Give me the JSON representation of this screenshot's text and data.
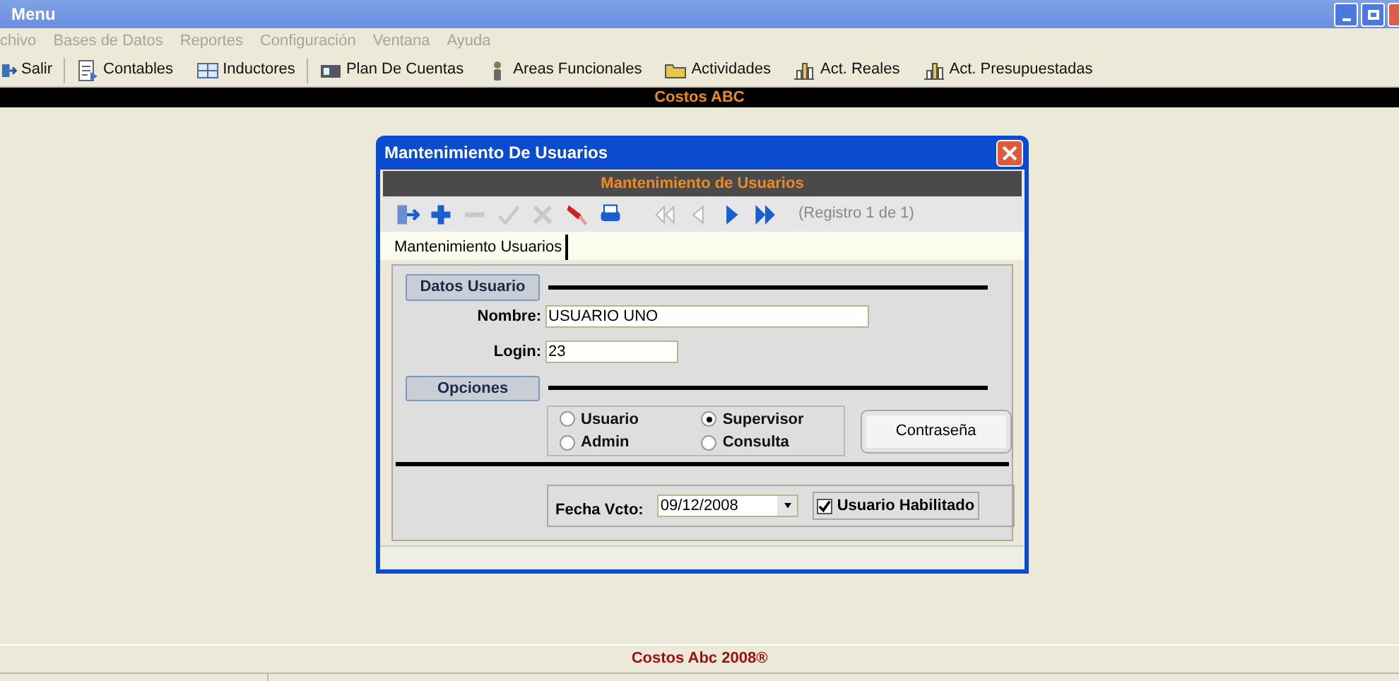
{
  "window": {
    "title": "Menu"
  },
  "menu": [
    {
      "label": "chivo",
      "disabled": true
    },
    {
      "label": "Bases de Datos",
      "disabled": true
    },
    {
      "label": "Reportes",
      "disabled": true
    },
    {
      "label": "Configuración",
      "disabled": true
    },
    {
      "label": "Ventana",
      "disabled": true
    },
    {
      "label": "Ayuda",
      "disabled": true
    }
  ],
  "toolbar": [
    {
      "label": "Salir",
      "kind": "exit",
      "separator_after": true
    },
    {
      "label": "Contables",
      "kind": "ledger"
    },
    {
      "label": "Inductores",
      "kind": "grid",
      "separator_after": true
    },
    {
      "label": "Plan De Cuentas",
      "kind": "card"
    },
    {
      "label": "Areas Funcionales",
      "kind": "person"
    },
    {
      "label": "Actividades",
      "kind": "folder"
    },
    {
      "label": "Act. Reales",
      "kind": "chart"
    },
    {
      "label": "Act. Presupuestadas",
      "kind": "chart"
    }
  ],
  "banner": "Costos ABC",
  "dialog": {
    "title": "Mantenimiento De Usuarios",
    "header": "Mantenimiento de Usuarios",
    "tools": [
      {
        "kind": "exit",
        "disabled": false
      },
      {
        "kind": "add",
        "disabled": false
      },
      {
        "kind": "remove",
        "disabled": true
      },
      {
        "kind": "confirm",
        "disabled": true
      },
      {
        "kind": "cancel",
        "disabled": true
      },
      {
        "kind": "edit",
        "disabled": false
      },
      {
        "kind": "print",
        "disabled": false
      },
      {
        "kind": "first",
        "disabled": true
      },
      {
        "kind": "prev",
        "disabled": true
      },
      {
        "kind": "next",
        "disabled": false
      },
      {
        "kind": "last",
        "disabled": false
      }
    ],
    "record": "(Registro 1 de 1)",
    "tabs": [
      {
        "label": "Mantenimiento Usuarios",
        "selected": true
      }
    ],
    "section_1": "Datos Usuario",
    "fields": [
      {
        "label": "Nombre:",
        "value": "USUARIO UNO"
      },
      {
        "label": "Login:",
        "value": "23"
      }
    ],
    "section_2": "Opciones",
    "roles": [
      {
        "label": "Usuario",
        "selected": false
      },
      {
        "label": "Supervisor",
        "selected": true
      },
      {
        "label": "Admin",
        "selected": false
      },
      {
        "label": "Consulta",
        "selected": false
      }
    ],
    "password_button": "Contraseña",
    "expiry": {
      "label": "Fecha Vcto:",
      "value": "09/12/2008"
    },
    "enabled": {
      "label": "Usuario Habilitado",
      "checked": true
    }
  },
  "footer": "Costos Abc 2008®"
}
